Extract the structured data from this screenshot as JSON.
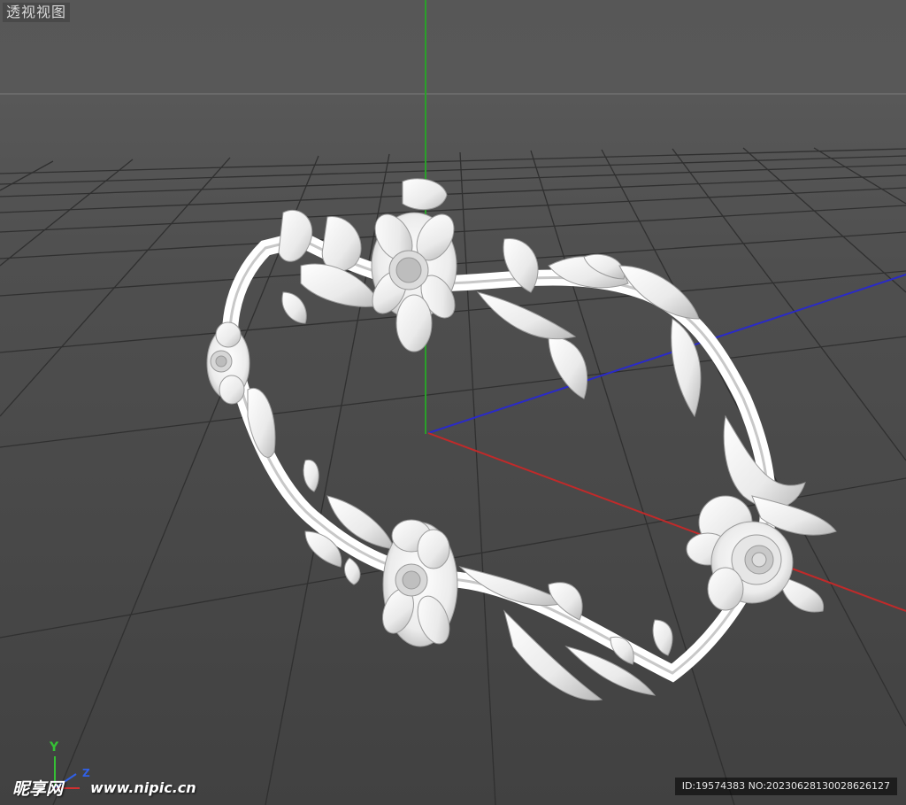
{
  "viewport": {
    "label": "透视视图"
  },
  "axis_widget": {
    "y_label": "Y",
    "z_label": "Z",
    "x_color": "#d03030",
    "y_color": "#35c035",
    "z_color": "#3060e8"
  },
  "watermark": {
    "logo_text": "昵享网",
    "url_text": "www.nipic.cn",
    "id_text": "ID:19574383 NO:20230628130028626127"
  },
  "colors": {
    "background": "#4f4f4f",
    "grid": "#2e2e2e",
    "horizon": "#6b6b6b",
    "axis_x": "#c02a2a",
    "axis_y": "#2aa02a",
    "axis_z": "#2a2ac8",
    "model": "#f2f2f2"
  },
  "model": {
    "icon": "ornate-floral-frame-model"
  }
}
